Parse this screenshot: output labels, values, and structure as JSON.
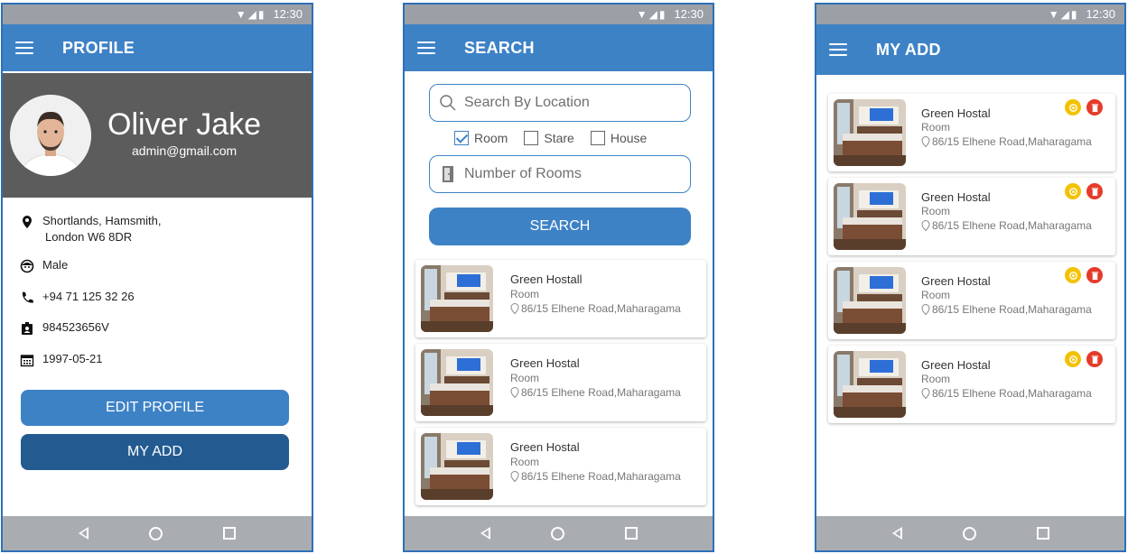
{
  "status": {
    "time": "12:30"
  },
  "nav": {
    "back": "back-icon",
    "home": "home-icon",
    "recent": "recent-apps-icon"
  },
  "profile_screen": {
    "title": "PROFILE",
    "name": "Oliver Jake",
    "email": "admin@gmail.com",
    "address_line1": "Shortlands, Hamsmith,",
    "address_line2": "London W6 8DR",
    "gender": "Male",
    "phone": "+94 71 125 32 26",
    "id_number": "984523656V",
    "birthday": "1997-05-21",
    "edit_button": "EDIT PROFILE",
    "my_add_button": "MY ADD"
  },
  "search_screen": {
    "title": "SEARCH",
    "location_placeholder": "Search By Location",
    "checkboxes": [
      {
        "label": "Room",
        "checked": true
      },
      {
        "label": "Stare",
        "checked": false
      },
      {
        "label": "House",
        "checked": false
      }
    ],
    "rooms_placeholder": "Number of Rooms",
    "search_button": "SEARCH",
    "results": [
      {
        "title": "Green Hostall",
        "type": "Room",
        "address": "86/15 Elhene Road,Maharagama"
      },
      {
        "title": "Green Hostal",
        "type": "Room",
        "address": "86/15 Elhene Road,Maharagama"
      },
      {
        "title": "Green Hostal",
        "type": "Room",
        "address": "86/15 Elhene Road,Maharagama"
      }
    ]
  },
  "myadd_screen": {
    "title": "MY ADD",
    "items": [
      {
        "title": "Green Hostal",
        "type": "Room",
        "address": "86/15 Elhene Road,Maharagama"
      },
      {
        "title": "Green Hostal",
        "type": "Room",
        "address": "86/15 Elhene Road,Maharagama"
      },
      {
        "title": "Green Hostal",
        "type": "Room",
        "address": "86/15 Elhene Road,Maharagama"
      },
      {
        "title": "Green Hostal",
        "type": "Room",
        "address": "86/15 Elhene Road,Maharagama"
      }
    ]
  },
  "colors": {
    "primary": "#3e82c6",
    "dark": "#235b91",
    "edit": "#f2c200",
    "delete": "#e53b2a",
    "header_gray": "#5c5c5c"
  }
}
